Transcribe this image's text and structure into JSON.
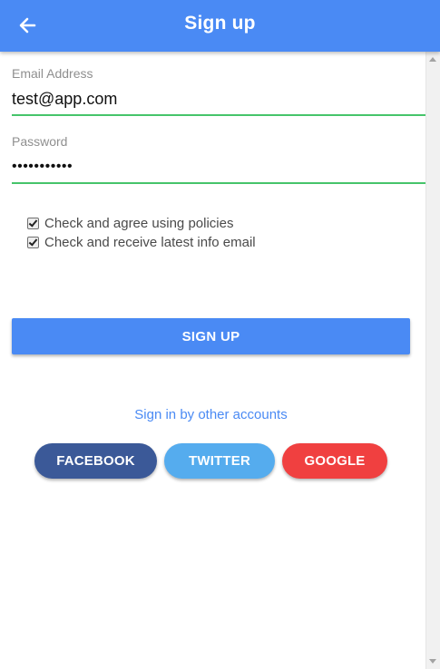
{
  "header": {
    "title": "Sign up",
    "back_icon": "arrow-left-icon"
  },
  "email": {
    "label": "Email Address",
    "value": "test@app.com"
  },
  "password": {
    "label": "Password",
    "value": "•••••••••••"
  },
  "checkboxes": [
    {
      "label": "Check and agree using policies",
      "checked": true
    },
    {
      "label": "Check and receive latest info email",
      "checked": true
    }
  ],
  "signup_button": "SIGN UP",
  "other_accounts_link": "Sign in by other accounts",
  "social": {
    "facebook": "FACEBOOK",
    "twitter": "TWITTER",
    "google": "GOOGLE"
  },
  "colors": {
    "primary": "#4a8af4",
    "input_underline": "#46c46a",
    "facebook": "#3b5998",
    "twitter": "#55acee",
    "google": "#f04040"
  }
}
